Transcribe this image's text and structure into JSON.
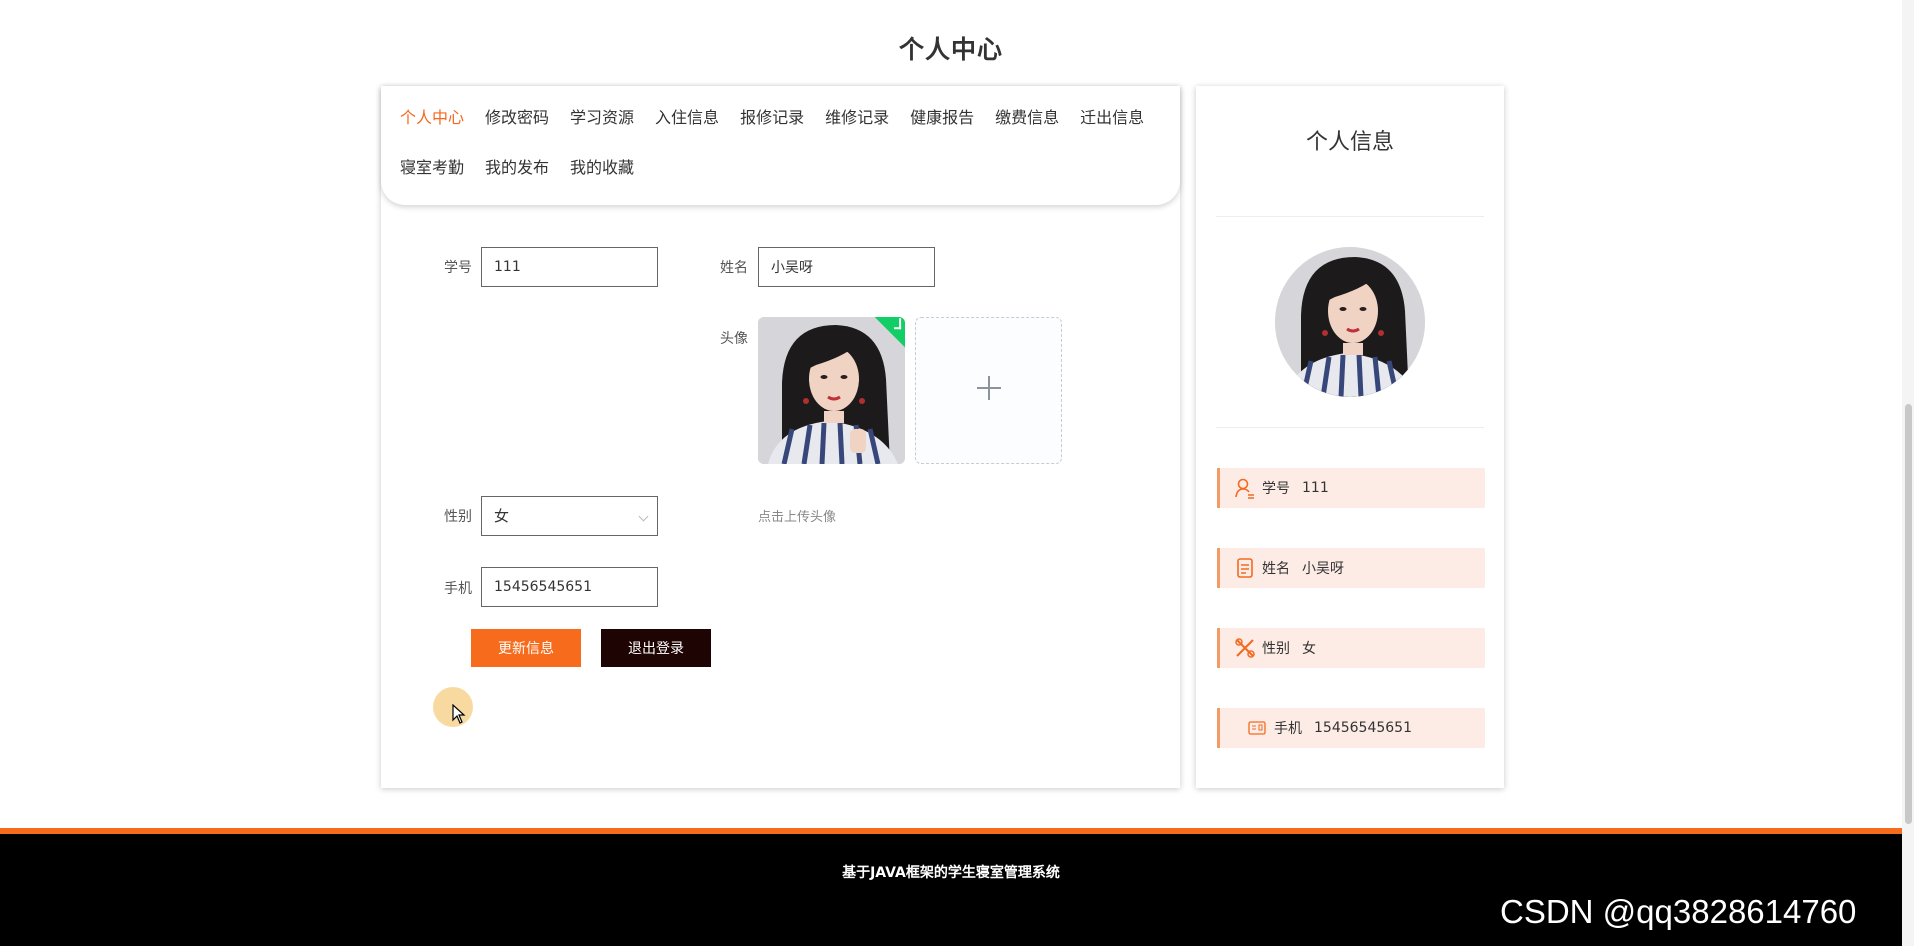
{
  "page": {
    "title": "个人中心"
  },
  "tabs": [
    {
      "label": "个人中心",
      "active": true
    },
    {
      "label": "修改密码"
    },
    {
      "label": "学习资源"
    },
    {
      "label": "入住信息"
    },
    {
      "label": "报修记录"
    },
    {
      "label": "维修记录"
    },
    {
      "label": "健康报告"
    },
    {
      "label": "缴费信息"
    },
    {
      "label": "迁出信息"
    },
    {
      "label": "寝室考勤"
    },
    {
      "label": "我的发布"
    },
    {
      "label": "我的收藏"
    }
  ],
  "form": {
    "student_id_label": "学号",
    "student_id_value": "111",
    "name_label": "姓名",
    "name_value": "小吴呀",
    "avatar_label": "头像",
    "upload_tip": "点击上传头像",
    "gender_label": "性别",
    "gender_value": "女",
    "phone_label": "手机",
    "phone_value": "15456545651",
    "update_button": "更新信息",
    "logout_button": "退出登录"
  },
  "info_card": {
    "title": "个人信息",
    "rows": [
      {
        "label": "学号",
        "value": "111",
        "icon": "user-id-icon"
      },
      {
        "label": "姓名",
        "value": "小吴呀",
        "icon": "document-icon"
      },
      {
        "label": "性别",
        "value": "女",
        "icon": "tools-icon"
      },
      {
        "label": "手机",
        "value": "15456545651",
        "icon": "id-card-icon"
      }
    ]
  },
  "footer": {
    "text": "基于JAVA框架的学生寝室管理系统"
  },
  "watermark": "CSDN @qq3828614760",
  "colors": {
    "accent": "#f76b1c",
    "dark_button": "#1f0404",
    "row_bg": "#fdece6",
    "success": "#13ce66"
  }
}
